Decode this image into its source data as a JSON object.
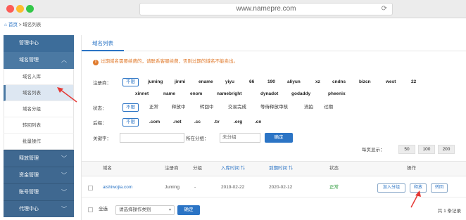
{
  "browser": {
    "url": "www.namepre.com"
  },
  "breadcrumb": {
    "home": "首页",
    "separator": ">",
    "current": "域名列表"
  },
  "sidebar": {
    "top": "管理中心",
    "groups": [
      {
        "label": "域名管理",
        "expanded": true,
        "items": [
          "域名入库",
          "域名列表",
          "域名分组",
          "转回列表",
          "批量操作"
        ]
      },
      {
        "label": "释放管理"
      },
      {
        "label": "资金管理"
      },
      {
        "label": "账号管理"
      },
      {
        "label": "代理中心"
      }
    ]
  },
  "main": {
    "tab": "域名列表",
    "notice": "过期域名需要续费的，请联系客服续费，否则过期的域名不能卖出。",
    "filters": {
      "registrar_label": "注册商：",
      "registrars_row1": [
        "不限",
        "juming",
        "jinmi",
        "ename",
        "yiyu",
        "66",
        "190",
        "aliyun",
        "xz",
        "cndns",
        "bizcn",
        "west",
        "22"
      ],
      "registrars_row2": [
        "xinnet",
        "name",
        "enom",
        "namebright",
        "dynadot",
        "godaddy",
        "pheenix"
      ],
      "status_label": "状态：",
      "statuses": [
        "不限",
        "正常",
        "释放中",
        "转回中",
        "交易完成",
        "等待释放审核",
        "流拍",
        "过期"
      ],
      "suffix_label": "后缀：",
      "suffixes": [
        "不限",
        ".com",
        ".net",
        ".cc",
        ".tv",
        ".org",
        ".cn"
      ],
      "keyword_label": "关键字：",
      "keyword_value": "",
      "group_label": "所在分组：",
      "group_value": "未分组",
      "confirm": "确定"
    },
    "page_size": {
      "label": "每页显示：",
      "options": [
        "50",
        "100",
        "200"
      ]
    },
    "table": {
      "headers": [
        "域名",
        "注册商",
        "分组",
        "入库时间",
        "到期时间",
        "状态",
        "操作"
      ],
      "rows": [
        {
          "domain": "aishiwojia.com",
          "registrar": "Juming",
          "group": "-",
          "added": "2019-02-22",
          "expires": "2020-02-12",
          "status": "正常",
          "actions": [
            "加入分组",
            "释放",
            "转回"
          ]
        }
      ]
    },
    "footer": {
      "select_all": "全选",
      "bulk_placeholder": "请选择操作类别",
      "confirm": "确定",
      "total": "共 1 条记录"
    }
  },
  "colors": {
    "accent": "#2b74c5",
    "sidebar": "#4b79a3",
    "warning": "#e07a2c",
    "status_ok": "#2b9a3a",
    "annotation_arrow": "#e53935"
  }
}
